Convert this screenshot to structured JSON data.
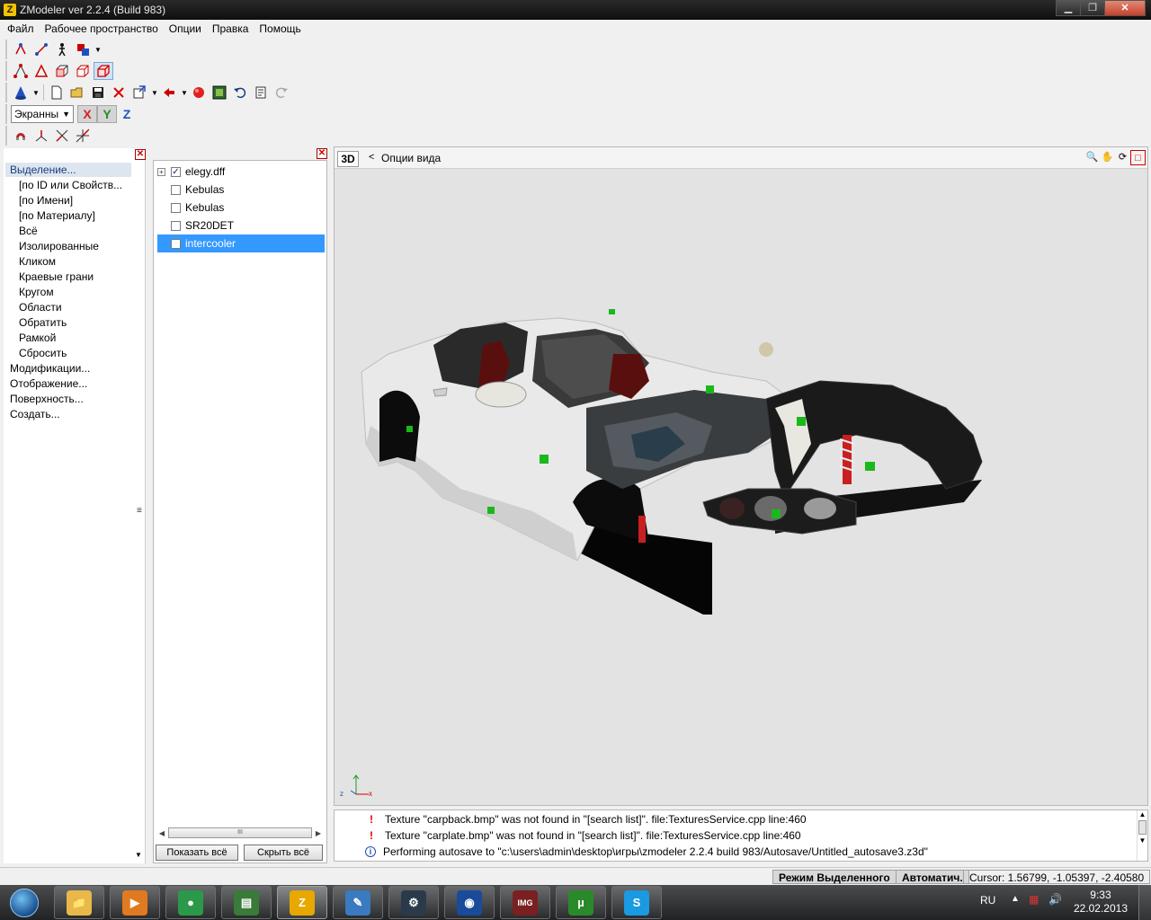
{
  "window": {
    "title": "ZModeler ver 2.2.4 (Build 983)",
    "app_icon": "Z",
    "controls": {
      "minimize": "▁",
      "maximize": "❐",
      "close": "✕"
    }
  },
  "menu": [
    "Файл",
    "Рабочее пространство",
    "Опции",
    "Правка",
    "Помощь"
  ],
  "toolbar": {
    "screen_select": "Экранны",
    "axes": {
      "x": "X",
      "y": "Y",
      "z": "Z"
    },
    "axis_colors": {
      "x": "#d42020",
      "y": "#2a8a2a",
      "z": "#2050c0"
    }
  },
  "left_panel": {
    "header": "Выделение...",
    "sub_items": [
      "[по ID или Свойств...",
      "[по Имени]",
      "[по Материалу]",
      "Всё",
      "Изолированные",
      "Кликом",
      "Краевые грани",
      "Кругом",
      "Области",
      "Обратить",
      "Рамкой",
      "Сбросить"
    ],
    "top_items": [
      "Модификации...",
      "Отображение...",
      "Поверхность...",
      "Создать..."
    ]
  },
  "list_panel": {
    "items": [
      {
        "name": "elegy.dff",
        "checked": true,
        "expandable": true
      },
      {
        "name": "Kebulas",
        "checked": false,
        "expandable": false
      },
      {
        "name": "Kebulas",
        "checked": false,
        "expandable": false
      },
      {
        "name": "SR20DET",
        "checked": false,
        "expandable": false
      },
      {
        "name": "intercooler",
        "checked": false,
        "expandable": false,
        "selected": true
      }
    ],
    "show_all": "Показать всё",
    "hide_all": "Скрыть всё",
    "scroll_thumb": "III"
  },
  "viewport": {
    "mode": "3D",
    "arrow": "<",
    "options_label": "Опции вида",
    "gizmo": {
      "z": "z",
      "x": "x"
    }
  },
  "log": [
    {
      "type": "error",
      "text": "Texture \"carpback.bmp\" was not found in \"[search list]\". file:TexturesService.cpp line:460"
    },
    {
      "type": "error",
      "text": "Texture \"carplate.bmp\" was not found in \"[search list]\". file:TexturesService.cpp line:460"
    },
    {
      "type": "info",
      "text": "Performing autosave to \"c:\\users\\admin\\desktop\\игры\\zmodeler 2.2.4 build 983/Autosave/Untitled_autosave3.z3d\""
    }
  ],
  "status": {
    "mode": "Режим Выделенного",
    "auto": "Автоматич.",
    "cursor": "Cursor: 1.56799, -1.05397, -2.40580"
  },
  "taskbar": {
    "apps": [
      {
        "name": "explorer",
        "glyph": "📁",
        "color": "#e8b84a"
      },
      {
        "name": "media-player",
        "glyph": "▶",
        "color": "#e07a20"
      },
      {
        "name": "chrome",
        "glyph": "●",
        "color": "#2a9a4a"
      },
      {
        "name": "notepad",
        "glyph": "▤",
        "color": "#3a7a3a"
      },
      {
        "name": "zmodeler",
        "glyph": "Z",
        "color": "#e8a800"
      },
      {
        "name": "paint",
        "glyph": "✎",
        "color": "#3a7ac0"
      },
      {
        "name": "steam",
        "glyph": "⚙",
        "color": "#2a3a4a"
      },
      {
        "name": "globe",
        "glyph": "◉",
        "color": "#1a4a9a"
      },
      {
        "name": "img-editor",
        "glyph": "IMG",
        "color": "#7a2020"
      },
      {
        "name": "utorrent",
        "glyph": "µ",
        "color": "#2a8a2a"
      },
      {
        "name": "skype",
        "glyph": "S",
        "color": "#1a9ae0"
      }
    ],
    "lang": "RU",
    "time": "9:33",
    "date": "22.02.2013"
  }
}
